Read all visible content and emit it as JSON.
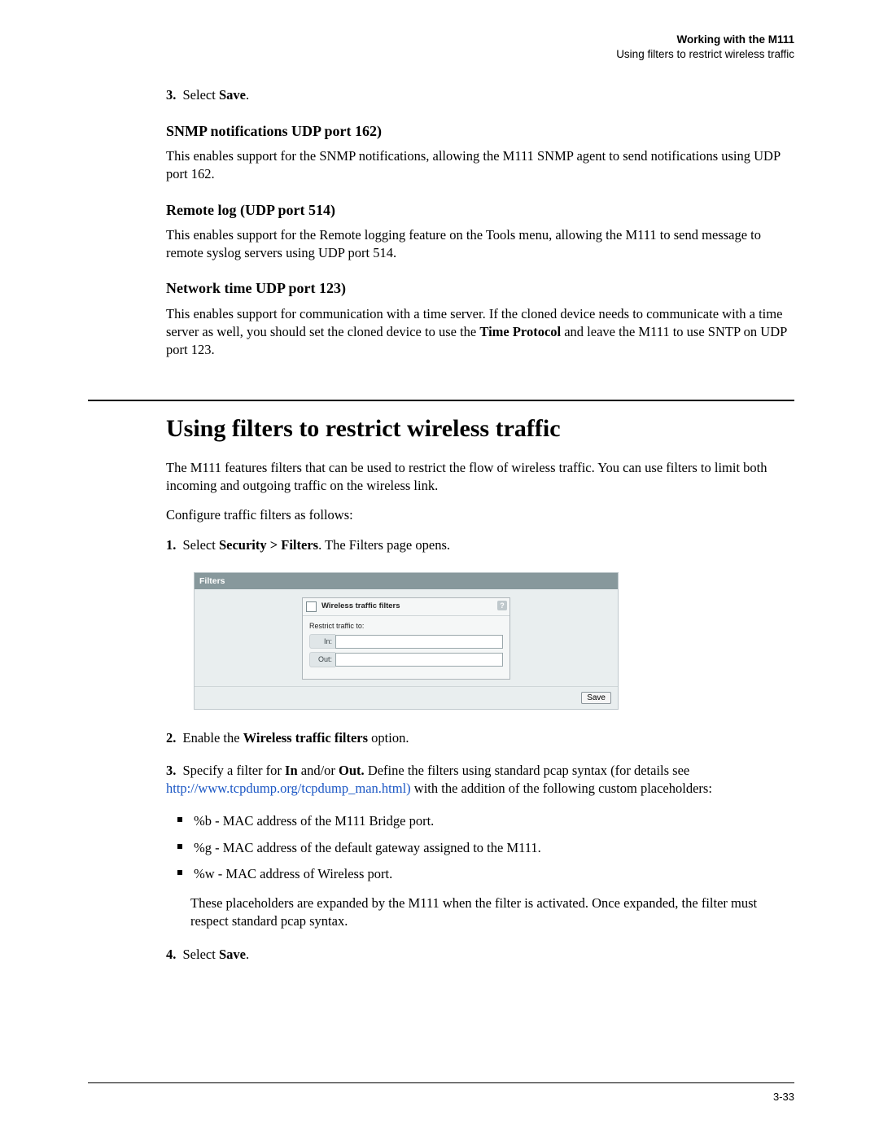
{
  "header": {
    "chapter": "Working with the M111",
    "section": "Using filters to restrict wireless traffic"
  },
  "prev_tail": {
    "step3_num": "3.",
    "step3_before": " Select ",
    "step3_bold": "Save",
    "step3_after": "."
  },
  "snmp": {
    "heading": "SNMP notifications UDP port 162)",
    "body": "This enables support for the SNMP notifications, allowing the M111 SNMP agent to send notifications using UDP port 162."
  },
  "remotelog": {
    "heading": "Remote log (UDP port 514)",
    "body": "This enables support for the Remote logging feature on the Tools menu, allowing the M111 to send message to remote syslog servers using UDP port 514."
  },
  "nettime": {
    "heading": "Network time UDP port 123)",
    "body_before": "This enables support for communication with a time server. If the cloned device needs to communicate with a time server as well, you should set the cloned device to use the ",
    "body_bold": "Time Protocol",
    "body_after": " and leave the M111 to use SNTP on UDP port 123."
  },
  "main": {
    "title": "Using filters to restrict wireless traffic",
    "intro1": "The M111 features filters that can be used to restrict the flow of wireless traffic. You can use filters to limit both incoming and outgoing traffic on the wireless link.",
    "intro2": "Configure traffic filters as follows:",
    "step1_num": "1.",
    "step1_before": " Select ",
    "step1_bold": "Security > Filters",
    "step1_after": ". The Filters page opens.",
    "step2_num": "2.",
    "step2_before": " Enable the ",
    "step2_bold": "Wireless traffic filters",
    "step2_after": " option.",
    "step3_num": "3.",
    "step3_a": " Specify a filter for ",
    "step3_boldIn": "In",
    "step3_b": " and/or ",
    "step3_boldOut": "Out.",
    "step3_c": " Define the filters using standard pcap syntax (for details see ",
    "step3_link": "http://www.tcpdump.org/tcpdump_man.html)",
    "step3_d": " with the addition of the following custom placeholders:",
    "bullets": {
      "b1": "%b - MAC address of the M111 Bridge port.",
      "b2": "%g - MAC address of the default gateway assigned to the M111.",
      "b3": "%w - MAC address of Wireless port."
    },
    "step3_trail": "These placeholders are expanded by the M111 when the filter is activated. Once expanded, the filter must respect standard pcap syntax.",
    "step4_num": "4.",
    "step4_before": " Select ",
    "step4_bold": "Save",
    "step4_after": "."
  },
  "panel": {
    "title": "Filters",
    "box_label": "Wireless traffic filters",
    "help": "?",
    "restrict_label": "Restrict traffic to:",
    "in_label": "In:",
    "out_label": "Out:",
    "in_value": "",
    "out_value": "",
    "save_label": "Save"
  },
  "folio": "3-33"
}
